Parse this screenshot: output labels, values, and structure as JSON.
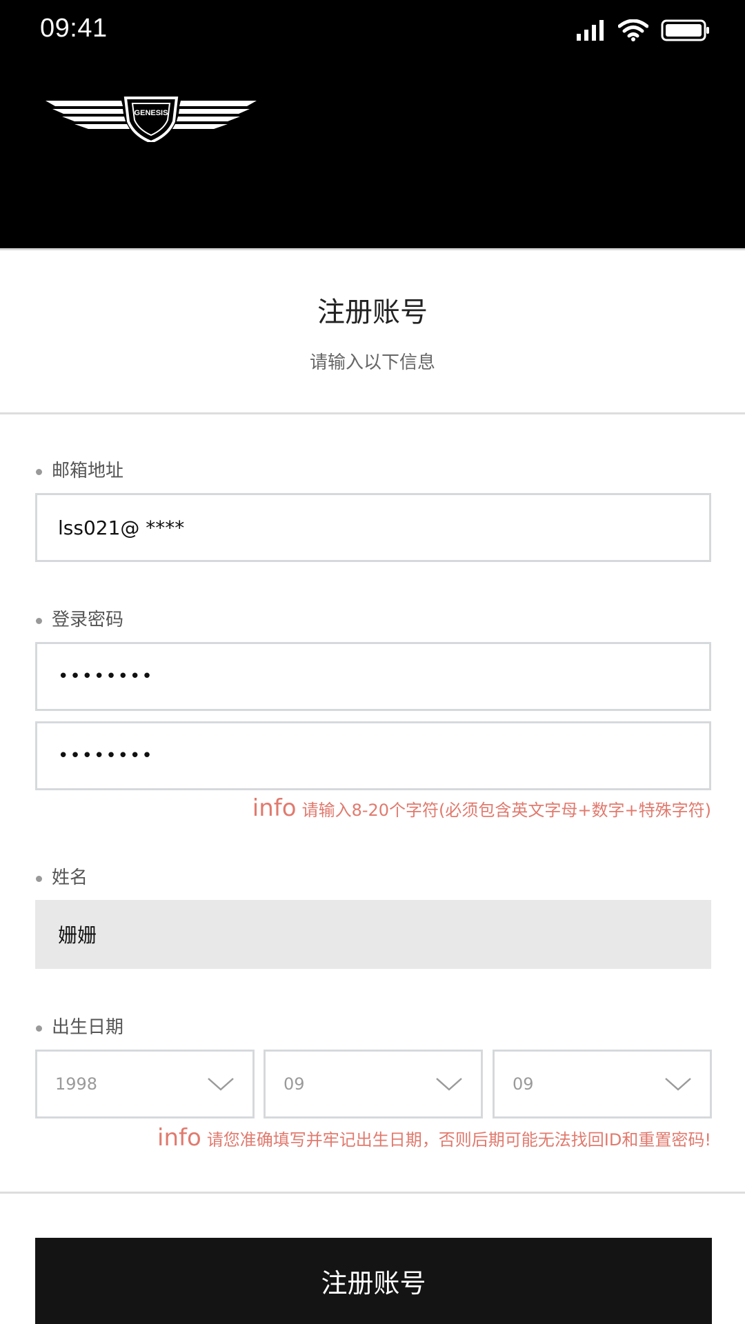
{
  "status_bar": {
    "time": "09:41",
    "icons": [
      "signal-icon",
      "wifi-icon",
      "battery-icon"
    ]
  },
  "brand": {
    "logo_text": "GENESIS"
  },
  "header": {
    "title": "注册账号",
    "subtitle": "请输入以下信息"
  },
  "form": {
    "email": {
      "label": "邮箱地址",
      "value": "lss021@ ****"
    },
    "password": {
      "label": "登录密码",
      "value": "••••••••",
      "confirm_value": "••••••••",
      "hint_prefix": "info",
      "hint": "请输入8-20个字符(必须包含英文字母+数字+特殊字符)"
    },
    "name": {
      "label": "姓名",
      "value": "姗姗"
    },
    "birthdate": {
      "label": "出生日期",
      "year": "1998",
      "month": "09",
      "day": "09",
      "hint_prefix": "info",
      "hint": "请您准确填写并牢记出生日期，否则后期可能无法找回ID和重置密码!"
    }
  },
  "submit": {
    "label": "注册账号"
  },
  "colors": {
    "header_bg": "#000000",
    "hint": "#e07a6e",
    "button_bg": "#141414"
  }
}
